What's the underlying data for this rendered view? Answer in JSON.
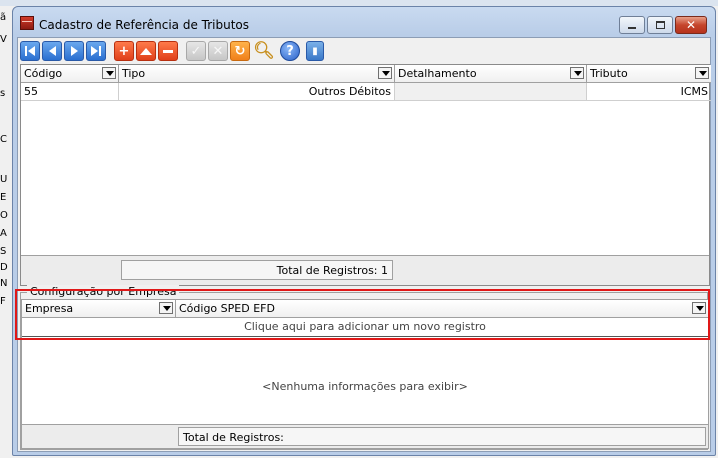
{
  "window": {
    "title": "Cadastro de Referência de Tributos",
    "buttons": {
      "minimize": "—",
      "maximize": "□",
      "close": "✕"
    }
  },
  "toolbar": {
    "buttons": [
      "first-icon",
      "prev-icon",
      "next-icon",
      "last-icon",
      "add-icon",
      "up-icon",
      "remove-icon",
      "confirm-icon",
      "cancel-icon",
      "refresh-icon",
      "search-icon",
      "help-icon",
      "exit-icon"
    ]
  },
  "main_grid": {
    "columns": [
      "Código",
      "Tipo",
      "Detalhamento",
      "Tributo"
    ],
    "rows": [
      {
        "codigo": "55",
        "tipo": "Outros Débitos",
        "detalhamento": "",
        "tributo": "ICMS"
      }
    ],
    "total": "Total de Registros: 1"
  },
  "empresa_section": {
    "legend": "Configuração por Empresa",
    "columns": [
      "Empresa",
      "Código SPED EFD"
    ],
    "add_row_text": "Clique aqui para adicionar um novo registro",
    "empty_text": "<Nenhuma informações para exibir>",
    "total": "Total de Registros:"
  },
  "background_letters": [
    "ã",
    "V",
    "s",
    "C",
    "U",
    "E",
    "O",
    "A",
    "S",
    "D",
    "N",
    "F"
  ],
  "colors": {
    "highlight": "#e01818",
    "title_bar": "#b9cde8"
  }
}
